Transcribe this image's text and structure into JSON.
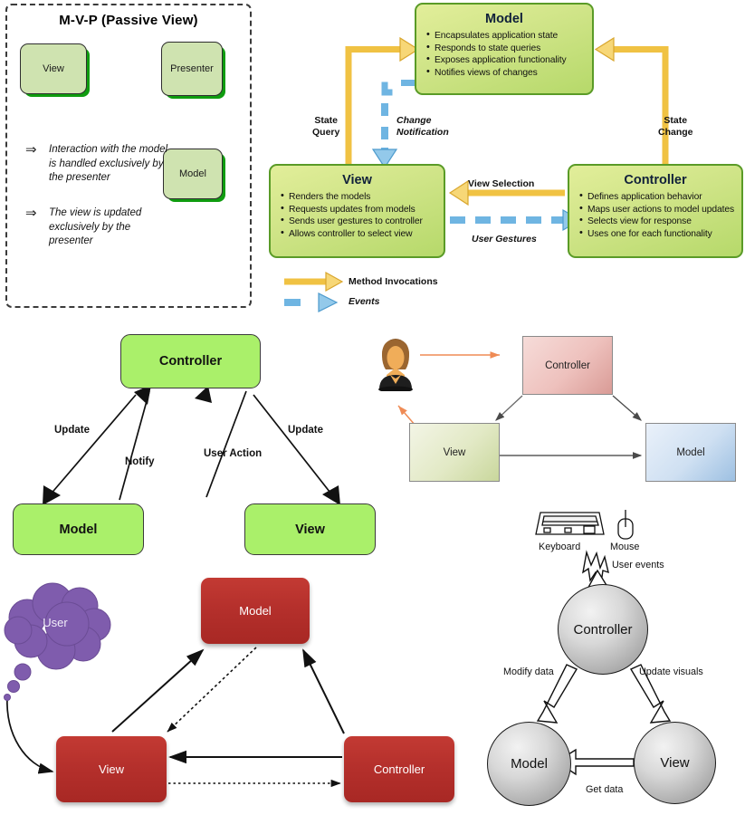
{
  "panels": {
    "mvp": {
      "title": "M-V-P (Passive View)",
      "nodes": {
        "view": "View",
        "presenter": "Presenter",
        "model": "Model"
      },
      "notes": [
        "Interaction with the model is handled exclusively by the presenter",
        "The view is updated exclusively by the presenter"
      ],
      "note_arrow": "⇒"
    },
    "mvc_detailed": {
      "model": {
        "title": "Model",
        "bullets": [
          "Encapsulates application state",
          "Responds to state queries",
          "Exposes application functionality",
          "Notifies views of changes"
        ]
      },
      "view": {
        "title": "View",
        "bullets": [
          "Renders the models",
          "Requests updates from models",
          "Sends user gestures to controller",
          "Allows controller to select view"
        ]
      },
      "controller": {
        "title": "Controller",
        "bullets": [
          "Defines application behavior",
          "Maps user actions to model updates",
          "Selects view for response",
          "Uses one for each functionality"
        ]
      },
      "edges": {
        "state_query": "State\nQuery",
        "state_query_l1": "State",
        "state_query_l2": "Query",
        "state_change_l1": "State",
        "state_change_l2": "Change",
        "change_notification_l1": "Change",
        "change_notification_l2": "Notification",
        "view_selection": "View Selection",
        "user_gestures": "User Gestures"
      },
      "legend": {
        "method_invocations": "Method Invocations",
        "events": "Events"
      },
      "colors": {
        "arrow_method": "#f4c842",
        "arrow_event": "#66b3e0",
        "box_border": "#5a9b27"
      }
    },
    "mvc_triangle": {
      "nodes": {
        "controller": "Controller",
        "model": "Model",
        "view": "View"
      },
      "edges": {
        "update_left": "Update",
        "notify": "Notify",
        "user_action": "User Action",
        "update_right": "Update"
      },
      "colors": {
        "box_fill": "#aaf06a"
      }
    },
    "mvc_gradient": {
      "nodes": {
        "controller": "Controller",
        "view": "View",
        "model": "Model"
      },
      "actor": "user-avatar",
      "colors": {
        "controller": "#e5b0ab",
        "view": "#d7e2b0",
        "model": "#b5cfe8",
        "arrow": "#ef8b55"
      }
    },
    "mvc_red": {
      "nodes": {
        "user": "User",
        "model": "Model",
        "view": "View",
        "controller": "Controller"
      },
      "colors": {
        "box_fill": "#b5302c",
        "cloud_fill": "#7f5cad"
      }
    },
    "mvc_circles": {
      "nodes": {
        "controller": "Controller",
        "model": "Model",
        "view": "View"
      },
      "devices": {
        "keyboard": "Keyboard",
        "mouse": "Mouse"
      },
      "edges": {
        "user_events": "User events",
        "modify_data": "Modify data",
        "update_visuals": "Update visuals",
        "get_data": "Get data"
      },
      "colors": {
        "circle_fill": "#c8c8c8"
      }
    }
  }
}
